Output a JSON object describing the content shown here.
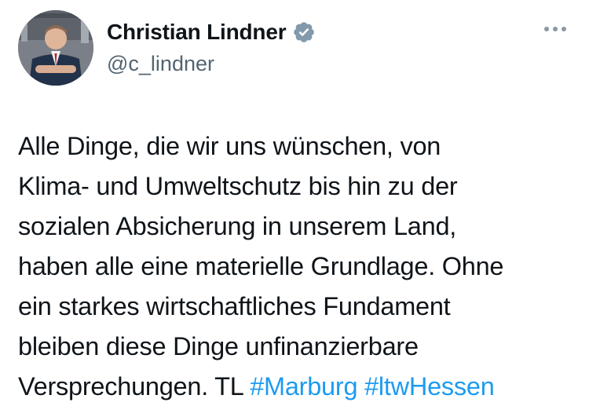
{
  "author": {
    "display_name": "Christian Lindner",
    "handle": "@c_lindner",
    "verified": true,
    "verified_color": "#829aab"
  },
  "icons": {
    "verified": "verified-badge-icon",
    "more": "more-options-icon"
  },
  "tweet": {
    "lines": [
      "Alle Dinge, die wir uns wünschen, von",
      "Klima- und Umweltschutz bis hin zu der",
      "sozialen Absicherung in unserem Land,",
      "haben alle eine materielle Grundlage. Ohne",
      "ein starkes wirtschaftliches Fundament",
      "bleiben diese Dinge unfinanzierbare",
      "Versprechungen. TL "
    ],
    "hashtags": [
      "#Marburg",
      "#ltwHessen"
    ]
  },
  "colors": {
    "text": "#0f1419",
    "secondary": "#536471",
    "link": "#1d9bf0"
  }
}
